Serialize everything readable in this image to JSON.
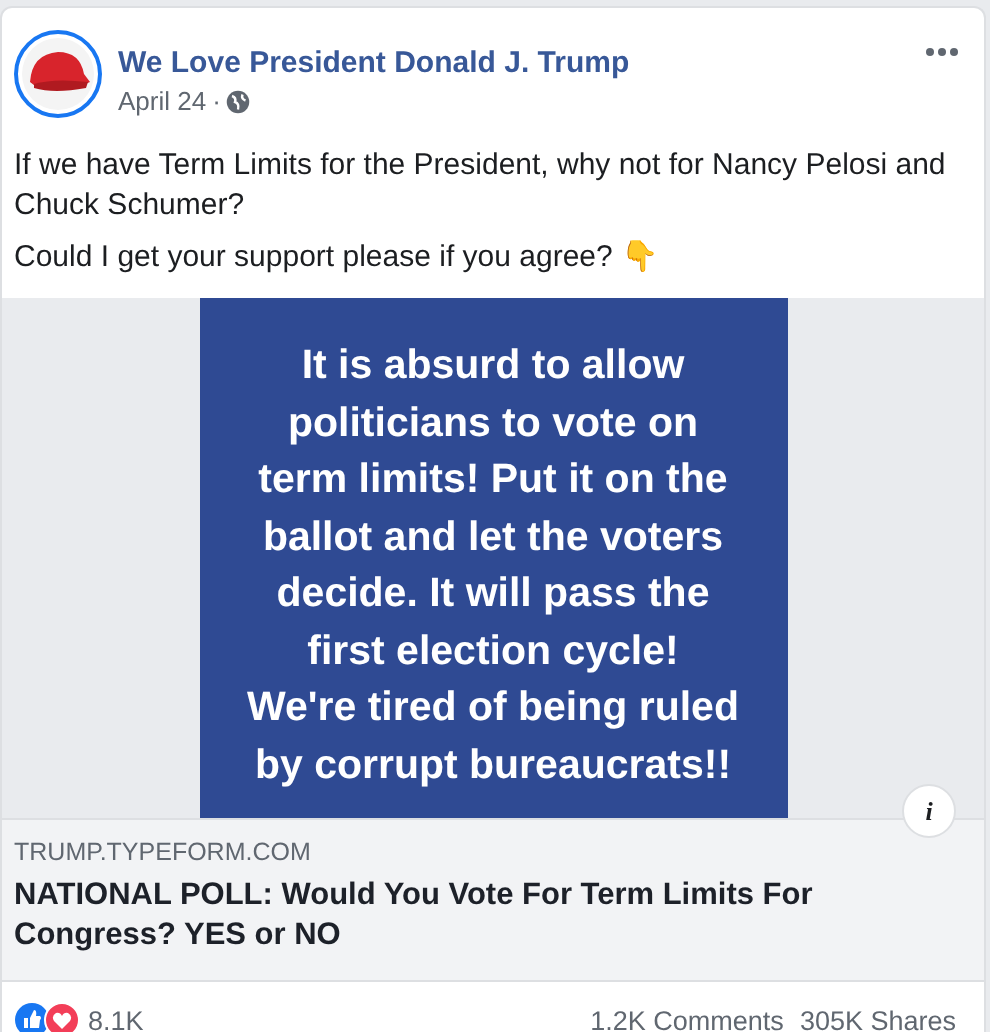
{
  "post": {
    "author": "We Love President Donald J. Trump",
    "date": "April 24",
    "separator": "·",
    "paragraphs": [
      "If we have Term Limits for the President, why not for Nancy Pelosi and Chuck Schumer?",
      "Could I get your support please if you agree? 👇"
    ],
    "image_text": "It is absurd to allow\npoliticians to vote on\nterm limits!  Put it on the\nballot and let the voters\ndecide.  It will pass the\nfirst election cycle!\nWe're tired of being ruled\nby corrupt bureaucrats!!",
    "info_button": "i",
    "link": {
      "domain": "TRUMP.TYPEFORM.COM",
      "title": "NATIONAL POLL: Would You Vote For Term Limits For Congress? YES or NO"
    },
    "reactions": {
      "count": "8.1K",
      "comments": "1.2K Comments",
      "shares": "305K Shares"
    }
  }
}
